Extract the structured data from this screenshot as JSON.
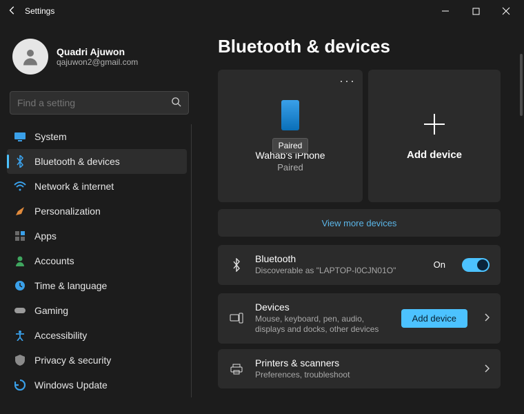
{
  "window": {
    "title": "Settings"
  },
  "profile": {
    "name": "Quadri Ajuwon",
    "email": "qajuwon2@gmail.com"
  },
  "search": {
    "placeholder": "Find a setting"
  },
  "nav": {
    "items": [
      {
        "label": "System",
        "icon": "monitor",
        "color": "#3aa0e9"
      },
      {
        "label": "Bluetooth & devices",
        "icon": "bluetooth",
        "color": "#3aa0e9",
        "active": true
      },
      {
        "label": "Network & internet",
        "icon": "wifi",
        "color": "#3aa0e9"
      },
      {
        "label": "Personalization",
        "icon": "brush",
        "color": "#e08a3c"
      },
      {
        "label": "Apps",
        "icon": "apps",
        "color": "#6a6a6a"
      },
      {
        "label": "Accounts",
        "icon": "person",
        "color": "#3fa65f"
      },
      {
        "label": "Time & language",
        "icon": "clock",
        "color": "#3aa0e9"
      },
      {
        "label": "Gaming",
        "icon": "gamepad",
        "color": "#9a9a9a"
      },
      {
        "label": "Accessibility",
        "icon": "accessibility",
        "color": "#3aa0e9"
      },
      {
        "label": "Privacy & security",
        "icon": "shield",
        "color": "#8a8a8a"
      },
      {
        "label": "Windows Update",
        "icon": "update",
        "color": "#3aa0e9"
      }
    ]
  },
  "page": {
    "title": "Bluetooth & devices"
  },
  "device_card": {
    "tooltip": "Paired",
    "name": "Wahab's iPhone",
    "status": "Paired"
  },
  "add_card": {
    "label": "Add device"
  },
  "viewmore": "View more devices",
  "bt_row": {
    "title": "Bluetooth",
    "subtitle": "Discoverable as \"LAPTOP-I0CJN01O\"",
    "state_label": "On"
  },
  "devices_row": {
    "title": "Devices",
    "subtitle": "Mouse, keyboard, pen, audio, displays and docks, other devices",
    "button": "Add device"
  },
  "printers_row": {
    "title": "Printers & scanners",
    "subtitle": "Preferences, troubleshoot"
  }
}
